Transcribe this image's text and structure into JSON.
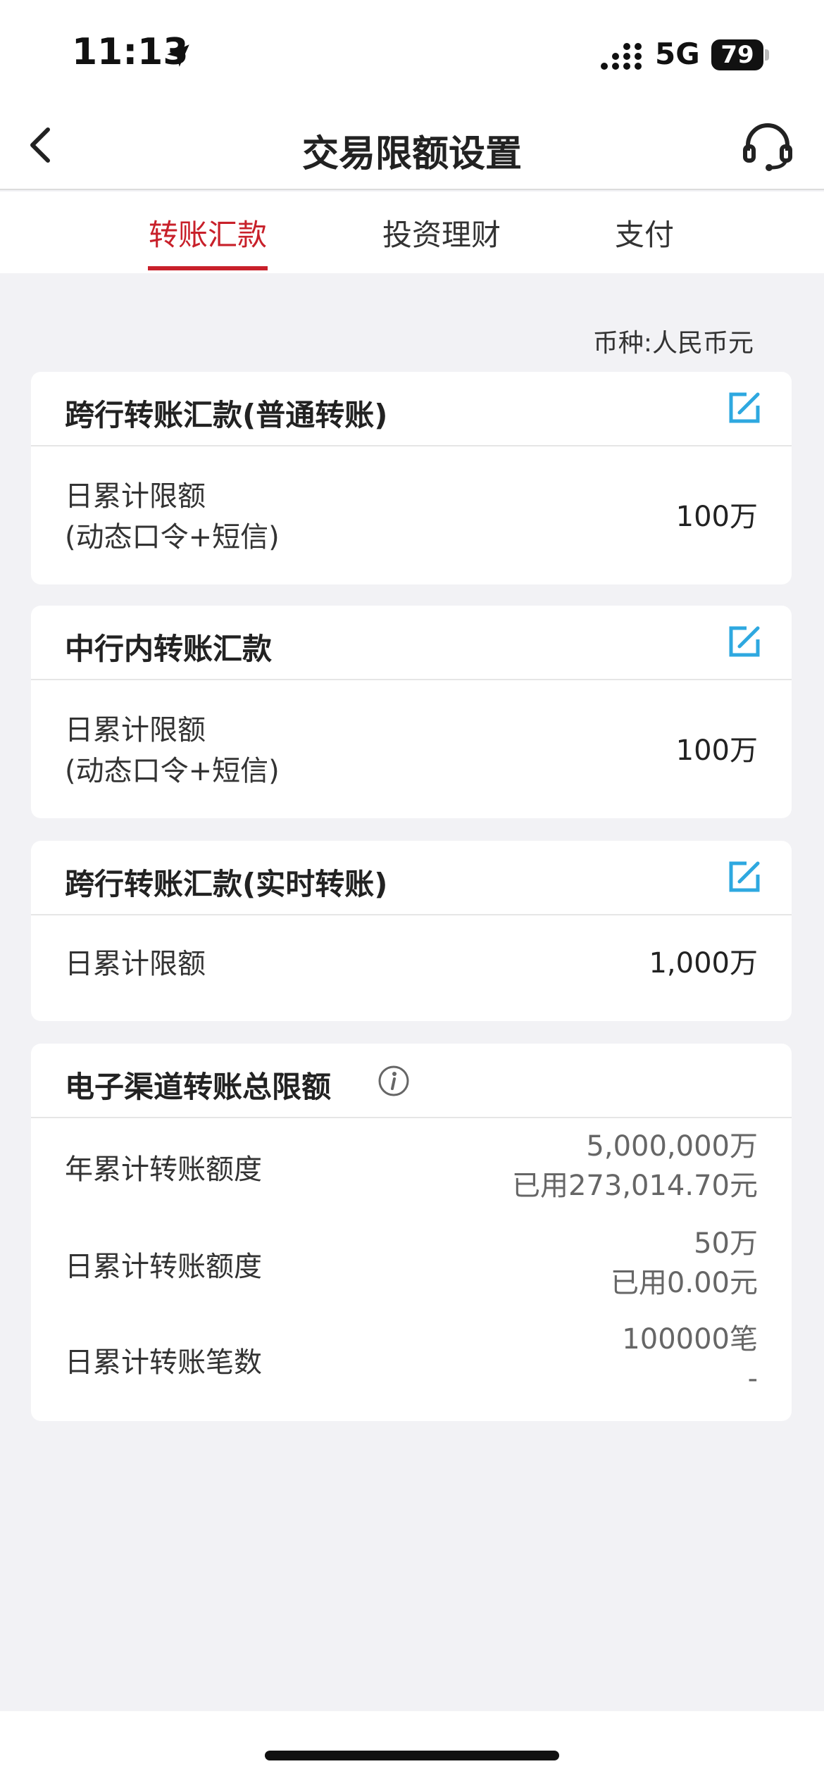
{
  "status_bar": {
    "time": "11:13",
    "network": "5G",
    "battery": "79"
  },
  "nav": {
    "title": "交易限额设置"
  },
  "tabs": [
    {
      "label": "转账汇款",
      "active": true
    },
    {
      "label": "投资理财",
      "active": false
    },
    {
      "label": "支付",
      "active": false
    }
  ],
  "currency_label": "币种:人民币元",
  "cards": [
    {
      "title": "跨行转账汇款(普通转账)",
      "rows": [
        {
          "label_line1": "日累计限额",
          "label_line2": "(动态口令+短信)",
          "value": "100万"
        }
      ]
    },
    {
      "title": "中行内转账汇款",
      "rows": [
        {
          "label_line1": "日累计限额",
          "label_line2": "(动态口令+短信)",
          "value": "100万"
        }
      ]
    },
    {
      "title": "跨行转账汇款(实时转账)",
      "rows": [
        {
          "label_line1": "日累计限额",
          "value": "1,000万"
        }
      ]
    }
  ],
  "total_card": {
    "title": "电子渠道转账总限额",
    "rows": [
      {
        "label": "年累计转账额度",
        "value": "5,000,000万",
        "used": "已用273,014.70元"
      },
      {
        "label": "日累计转账额度",
        "value": "50万",
        "used": "已用0.00元"
      },
      {
        "label": "日累计转账笔数",
        "value": "100000笔",
        "used": "-"
      }
    ]
  },
  "colors": {
    "accent": "#c8202a",
    "edit_icon": "#2ea8e0",
    "background": "#f2f2f5"
  },
  "icons": {
    "back": "chevron-left-icon",
    "support": "headset-icon",
    "edit": "edit-icon",
    "info": "info-icon",
    "location": "location-arrow-icon",
    "signal": "signal-icon"
  }
}
